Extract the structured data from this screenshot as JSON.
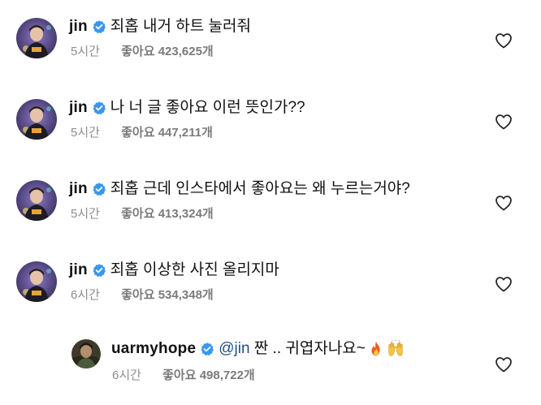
{
  "colors": {
    "verified_badge": "#3897f0",
    "meta_text": "#8e8e8e",
    "mention": "#1f4f8a"
  },
  "comments": [
    {
      "username": "jin",
      "verified": true,
      "text": "죄홉 내거 하트 눌러줘",
      "time": "5시간",
      "likes": "좋아요 423,625개"
    },
    {
      "username": "jin",
      "verified": true,
      "text": "나 너 글 좋아요 이런 뜻인가??",
      "time": "5시간",
      "likes": "좋아요 447,211개"
    },
    {
      "username": "jin",
      "verified": true,
      "text": "죄홉 근데 인스타에서 좋아요는 왜 누르는거야?",
      "time": "5시간",
      "likes": "좋아요 413,324개"
    },
    {
      "username": "jin",
      "verified": true,
      "text": "죄홉 이상한 사진 올리지마",
      "time": "6시간",
      "likes": "좋아요 534,348개"
    }
  ],
  "reply": {
    "username": "uarmyhope",
    "verified": true,
    "mention": "@jin",
    "text": " 짠 .. 귀엽자나요~",
    "emojis": [
      "fire-emoji",
      "raising-hands-emoji"
    ],
    "time": "6시간",
    "likes": "좋아요 498,722개"
  }
}
